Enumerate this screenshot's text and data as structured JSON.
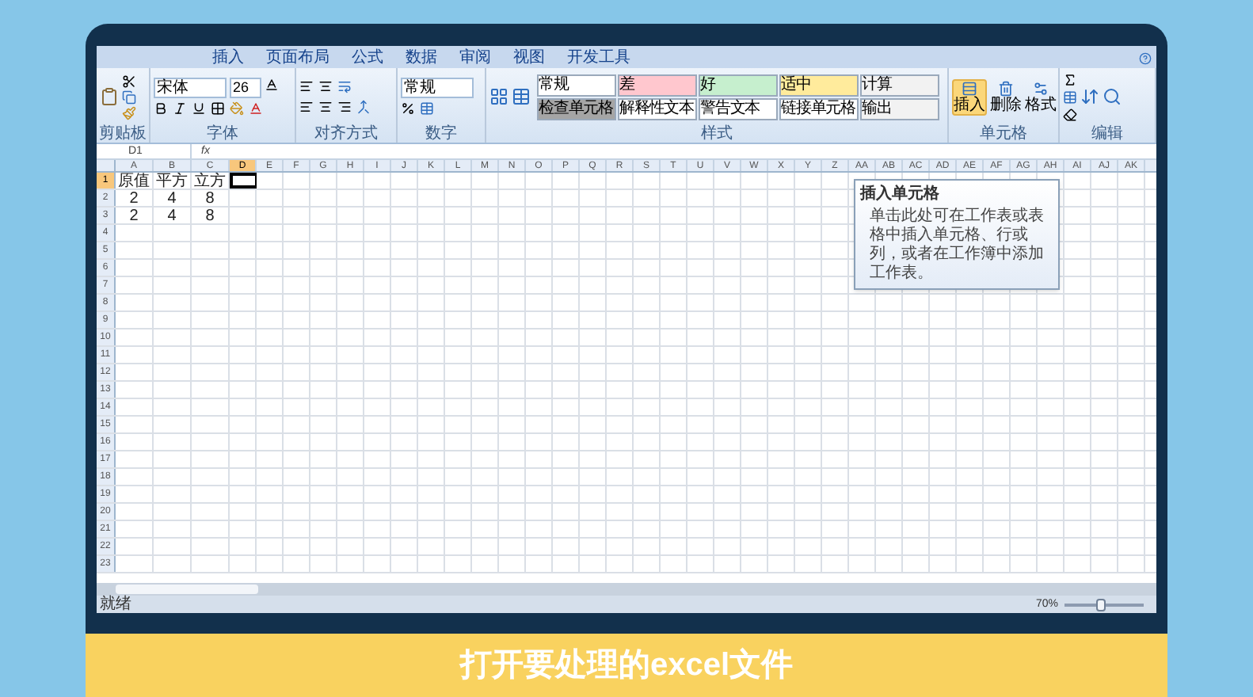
{
  "ribbon": {
    "tabs": [
      {
        "label": "插入",
        "selected": false
      },
      {
        "label": "页面布局",
        "selected": false
      },
      {
        "label": "公式",
        "selected": false
      },
      {
        "label": "数据",
        "selected": false
      },
      {
        "label": "审阅",
        "selected": false
      },
      {
        "label": "视图",
        "selected": false
      },
      {
        "label": "开发工具",
        "selected": false
      }
    ],
    "groups": [
      "剪贴板",
      "字体",
      "对齐方式",
      "数字",
      "样式",
      "单元格",
      "编辑"
    ],
    "font_name": "宋体",
    "font_size": "26",
    "number_format": "常规",
    "cell_styles": [
      {
        "label": "常规",
        "color": "#ffffff"
      },
      {
        "label": "差",
        "color": "#ffc7ce"
      },
      {
        "label": "好",
        "color": "#c6efce"
      },
      {
        "label": "适中",
        "color": "#ffeb9c"
      },
      {
        "label": "计算",
        "color": "#f2f2f2"
      },
      {
        "label": "检查单元格",
        "color": "#a5a5a5"
      },
      {
        "label": "解释性文本",
        "color": "#ffffff"
      },
      {
        "label": "警告文本",
        "color": "#ffffff"
      },
      {
        "label": "链接单元格",
        "color": "#ffffff"
      },
      {
        "label": "输出",
        "color": "#f2f2f2"
      }
    ],
    "cell_buttons": [
      {
        "label": "插入",
        "selected": true
      },
      {
        "label": "删除",
        "selected": false
      },
      {
        "label": "格式",
        "selected": false
      }
    ]
  },
  "formula_bar": {
    "name_box": "D1",
    "fx": "fx"
  },
  "tooltip": {
    "title": "插入单元格",
    "text": "单击此处可在工作表或表格中插入单元格、行或列，或者在工作簿中添加工作表。"
  },
  "sheet": {
    "columns": [
      {
        "label": "A",
        "selected": false
      },
      {
        "label": "B",
        "selected": false
      },
      {
        "label": "C",
        "selected": false
      },
      {
        "label": "D",
        "selected": true
      },
      {
        "label": "E",
        "selected": false
      },
      {
        "label": "F",
        "selected": false
      },
      {
        "label": "G",
        "selected": false
      },
      {
        "label": "H",
        "selected": false
      },
      {
        "label": "I",
        "selected": false
      },
      {
        "label": "J",
        "selected": false
      },
      {
        "label": "K",
        "selected": false
      },
      {
        "label": "L",
        "selected": false
      },
      {
        "label": "M",
        "selected": false
      },
      {
        "label": "N",
        "selected": false
      },
      {
        "label": "O",
        "selected": false
      },
      {
        "label": "P",
        "selected": false
      },
      {
        "label": "Q",
        "selected": false
      },
      {
        "label": "R",
        "selected": false
      },
      {
        "label": "S",
        "selected": false
      },
      {
        "label": "T",
        "selected": false
      },
      {
        "label": "U",
        "selected": false
      },
      {
        "label": "V",
        "selected": false
      },
      {
        "label": "W",
        "selected": false
      },
      {
        "label": "X",
        "selected": false
      },
      {
        "label": "Y",
        "selected": false
      },
      {
        "label": "Z",
        "selected": false
      },
      {
        "label": "AA",
        "selected": false
      },
      {
        "label": "AB",
        "selected": false
      },
      {
        "label": "AC",
        "selected": false
      },
      {
        "label": "AD",
        "selected": false
      },
      {
        "label": "AE",
        "selected": false
      },
      {
        "label": "AF",
        "selected": false
      },
      {
        "label": "AG",
        "selected": false
      },
      {
        "label": "AH",
        "selected": false
      },
      {
        "label": "AI",
        "selected": false
      },
      {
        "label": "AJ",
        "selected": false
      },
      {
        "label": "AK",
        "selected": false
      }
    ],
    "rows": [
      {
        "label": "1",
        "selected": true,
        "cells": [
          "原值",
          "平方",
          "立方"
        ]
      },
      {
        "label": "2",
        "selected": false,
        "cells": [
          "2",
          "4",
          "8"
        ]
      },
      {
        "label": "3",
        "selected": false,
        "cells": [
          "2",
          "4",
          "8"
        ]
      },
      {
        "label": "4",
        "selected": false
      },
      {
        "label": "5",
        "selected": false
      },
      {
        "label": "6",
        "selected": false
      },
      {
        "label": "7",
        "selected": false
      },
      {
        "label": "8",
        "selected": false
      },
      {
        "label": "9",
        "selected": false
      },
      {
        "label": "10",
        "selected": false
      },
      {
        "label": "11",
        "selected": false
      },
      {
        "label": "12",
        "selected": false
      },
      {
        "label": "13",
        "selected": false
      },
      {
        "label": "14",
        "selected": false
      },
      {
        "label": "15",
        "selected": false
      },
      {
        "label": "16",
        "selected": false
      },
      {
        "label": "17",
        "selected": false
      },
      {
        "label": "18",
        "selected": false
      },
      {
        "label": "19",
        "selected": false
      },
      {
        "label": "20",
        "selected": false
      },
      {
        "label": "21",
        "selected": false
      },
      {
        "label": "22",
        "selected": false
      },
      {
        "label": "23",
        "selected": false
      }
    ]
  },
  "status_bar": {
    "status": "就绪",
    "zoom": "70%",
    "zoom_slider": {
      "level": 0.45
    }
  },
  "caption": "打开要处理的excel文件"
}
